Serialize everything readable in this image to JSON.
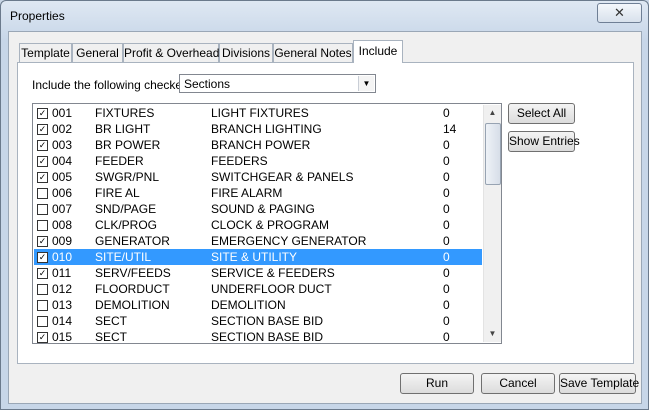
{
  "window": {
    "title": "Properties",
    "close_icon": "close-icon"
  },
  "tabs": [
    {
      "label": "Template"
    },
    {
      "label": "General"
    },
    {
      "label": "Profit & Overhead"
    },
    {
      "label": "Divisions"
    },
    {
      "label": "General Notes"
    },
    {
      "label": "Include",
      "active": true
    }
  ],
  "include": {
    "label": "Include the following checked",
    "select_value": "Sections",
    "rows": [
      {
        "checked": true,
        "num": "001",
        "code": "FIXTURES",
        "desc": "LIGHT FIXTURES",
        "count": "0"
      },
      {
        "checked": true,
        "num": "002",
        "code": "BR LIGHT",
        "desc": "BRANCH LIGHTING",
        "count": "14"
      },
      {
        "checked": true,
        "num": "003",
        "code": "BR POWER",
        "desc": "BRANCH POWER",
        "count": "0"
      },
      {
        "checked": true,
        "num": "004",
        "code": "FEEDER",
        "desc": "FEEDERS",
        "count": "0"
      },
      {
        "checked": true,
        "num": "005",
        "code": "SWGR/PNL",
        "desc": "SWITCHGEAR & PANELS",
        "count": "0"
      },
      {
        "checked": false,
        "num": "006",
        "code": "FIRE AL",
        "desc": "FIRE ALARM",
        "count": "0"
      },
      {
        "checked": false,
        "num": "007",
        "code": "SND/PAGE",
        "desc": "SOUND & PAGING",
        "count": "0"
      },
      {
        "checked": false,
        "num": "008",
        "code": "CLK/PROG",
        "desc": "CLOCK & PROGRAM",
        "count": "0"
      },
      {
        "checked": true,
        "num": "009",
        "code": "GENERATOR",
        "desc": "EMERGENCY GENERATOR",
        "count": "0"
      },
      {
        "checked": true,
        "num": "010",
        "code": "SITE/UTIL",
        "desc": "SITE & UTILITY",
        "count": "0",
        "selected": true
      },
      {
        "checked": true,
        "num": "011",
        "code": "SERV/FEEDS",
        "desc": "SERVICE & FEEDERS",
        "count": "0"
      },
      {
        "checked": false,
        "num": "012",
        "code": "FLOORDUCT",
        "desc": "UNDERFLOOR DUCT",
        "count": "0"
      },
      {
        "checked": false,
        "num": "013",
        "code": "DEMOLITION",
        "desc": "DEMOLITION",
        "count": "0"
      },
      {
        "checked": false,
        "num": "014",
        "code": "SECT",
        "desc": "SECTION BASE BID",
        "count": "0"
      },
      {
        "checked": true,
        "num": "015",
        "code": "SECT",
        "desc": "SECTION BASE BID",
        "count": "0"
      }
    ],
    "select_all": "Select All",
    "show_entries": "Show Entries"
  },
  "footer": {
    "run": "Run",
    "cancel": "Cancel",
    "save_template": "Save Template"
  },
  "colors": {
    "selection": "#3399ff",
    "window_frame": "#c7d6e8"
  }
}
